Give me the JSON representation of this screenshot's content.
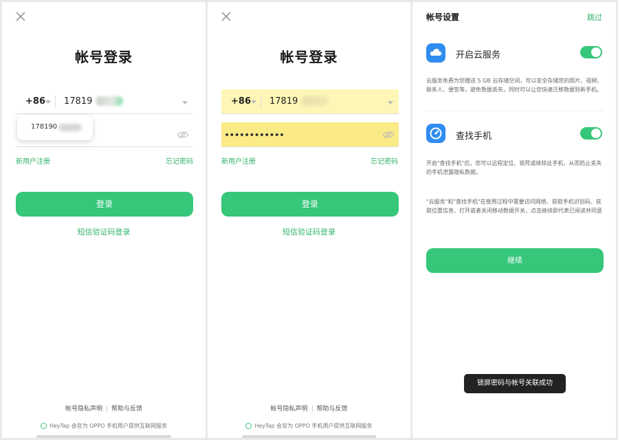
{
  "panel1": {
    "title": "帐号登录",
    "country_code": "+86",
    "phone_value": "17819",
    "suggestion_value": "178190",
    "new_user_link": "新用户注册",
    "forgot_link": "忘记密码",
    "login_button": "登录",
    "sms_login_link": "短信验证码登录",
    "privacy_link": "帐号隐私声明",
    "help_link": "帮助与反馈",
    "footer_note": "HeyTap 会官为 OPPO 手机用户提供互联网服务"
  },
  "panel2": {
    "title": "帐号登录",
    "country_code": "+86",
    "phone_value": "17819",
    "password_dots": "••••••••••••",
    "new_user_link": "新用户注册",
    "forgot_link": "忘记密码",
    "login_button": "登录",
    "sms_login_link": "短信验证码登录",
    "privacy_link": "帐号隐私声明",
    "help_link": "帮助与反馈",
    "footer_note": "HeyTap 会官为 OPPO 手机用户提供互联网服务"
  },
  "panel3": {
    "title": "帐号设置",
    "skip_link": "跳过",
    "cloud_label": "开启云服务",
    "cloud_toggle_on": true,
    "cloud_desc": "云服务免费为您赠送 5 GB 云存储空间，可以安全存储您的照片、视频、联系人、便签等，避免数据丢失，同时可以让您快速迁移数据到新手机。",
    "find_label": "查找手机",
    "find_toggle_on": true,
    "find_desc": "开启\"查找手机\"后，您可以远程定位、锁死或抹除此手机，从而防止丢失的手机泄露隐私数据。",
    "consent_desc": "\"云服务\"和\"查找手机\"在使用过程中需要访问网络、获取手机识别码、获取位置信息、打开或者关闭移动数据开关，点击继续即代表已阅读并同意",
    "continue_button": "继续",
    "toast": "锁屏密码与帐号关联成功"
  },
  "icons": {
    "close": "close-icon",
    "eye_hidden": "eye-hidden-icon",
    "cloud": "cloud-icon",
    "find_phone": "find-phone-icon",
    "info": "info-circle-icon"
  },
  "colors": {
    "accent": "#36c77a",
    "link": "#33b36a",
    "autofill_highlight": "#fdf6b6",
    "app_icon_blue": "#2f8cf0",
    "toast_bg": "#222222"
  }
}
